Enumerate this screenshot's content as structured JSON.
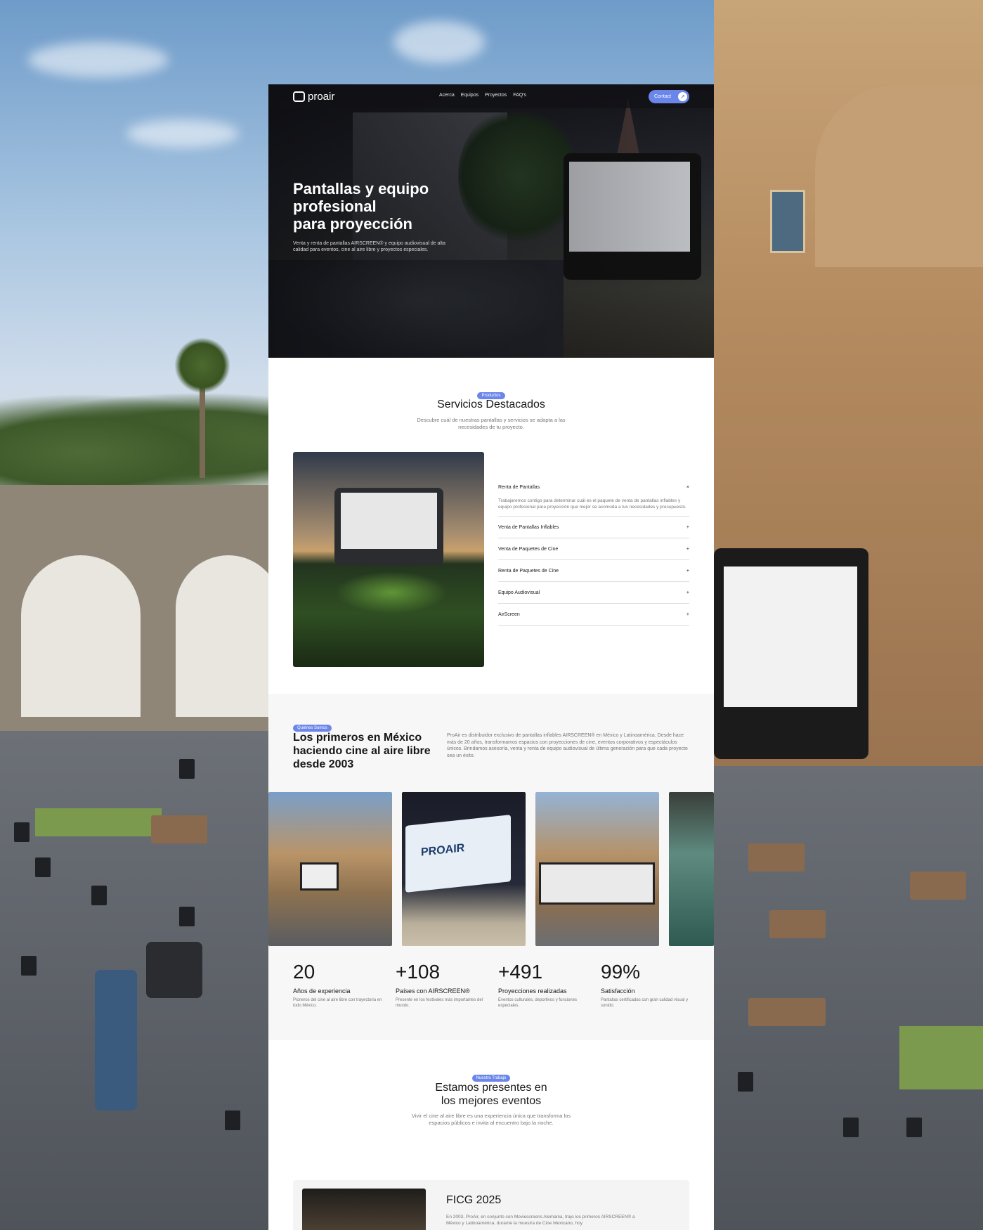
{
  "nav": {
    "logo": "proair",
    "links": [
      "Acerca",
      "Equipos",
      "Proyectos",
      "FAQ's"
    ],
    "contact": "Contact"
  },
  "hero": {
    "title_l1": "Pantallas y equipo",
    "title_l2": "profesional",
    "title_l3": "para proyección",
    "subtitle": "Venta y renta de pantallas AIRSCREEN® y equipo audiovisual de alta calidad para eventos, cine al aire libre y proyectos especiales."
  },
  "services": {
    "tag": "Productos",
    "title": "Servicios Destacados",
    "subtitle_l1": "Descubre cuál de nuestras pantallas y servicios se adapta a las",
    "subtitle_l2": "necesidades de tu proyecto.",
    "items": [
      {
        "label": "Renta de Pantallas",
        "icon": "×",
        "body": "Trabajaremos contigo para determinar cuál es el paquete de venta de pantallas inflables y equipo profesional para proyección que mejor se acomoda a tus necesidades y presupuesto."
      },
      {
        "label": "Venta de Pantallas Inflables",
        "icon": "+"
      },
      {
        "label": "Venta de Paquetes de Cine",
        "icon": "+"
      },
      {
        "label": "Renta de Paquetes de Cine",
        "icon": "+"
      },
      {
        "label": "Equipo Audiovisual",
        "icon": "+"
      },
      {
        "label": "AirScreen",
        "icon": "+"
      }
    ]
  },
  "about": {
    "tag": "Quiénes Somos",
    "title": "Los primeros en México haciendo cine al aire libre desde 2003",
    "text": "ProAir es distribuidor exclusivo de pantallas inflables AIRSCREEN® en México y Latinoamérica. Desde hace más de 20 años, transformamos espacios con proyecciones de cine, eventos corporativos y espectáculos únicos. Brindamos asesoría, venta y renta de equipo audiovisual de última generación para que cada proyecto sea un éxito.",
    "gallery_screen_text": "PROAIR",
    "stats": [
      {
        "num": "20",
        "label": "Años de experiencia",
        "desc": "Pioneros del cine al aire libre con trayectoria en todo México."
      },
      {
        "num": "+108",
        "label": "Países con AIRSCREEN®",
        "desc": "Presente en los festivales más importantes del mundo."
      },
      {
        "num": "+491",
        "label": "Proyecciones realizadas",
        "desc": "Eventos culturales, deportivos y funciones especiales."
      },
      {
        "num": "99%",
        "label": "Satisfacción",
        "desc": "Pantallas certificadas con gran calidad visual y sonido."
      }
    ]
  },
  "work": {
    "tag": "Nuestro Trabajo",
    "title_l1": "Estamos presentes en",
    "title_l2": "los mejores eventos",
    "subtitle_l1": "Vivir el cine al aire libre es una experiencia única que transforma los",
    "subtitle_l2": "espacios públicos e invita al encuentro bajo la noche.",
    "event": {
      "title": "FICG 2025",
      "text": "En 2003, ProAir, en conjunto con Moviescreens Alemania, trajo los primeros AIRSCREEN® a México y Latinoamérica, durante la muestra de Cine Mexicano, hoy"
    }
  },
  "colors": {
    "accent": "#6b86ea",
    "dark": "#161616",
    "muted": "#777777"
  }
}
